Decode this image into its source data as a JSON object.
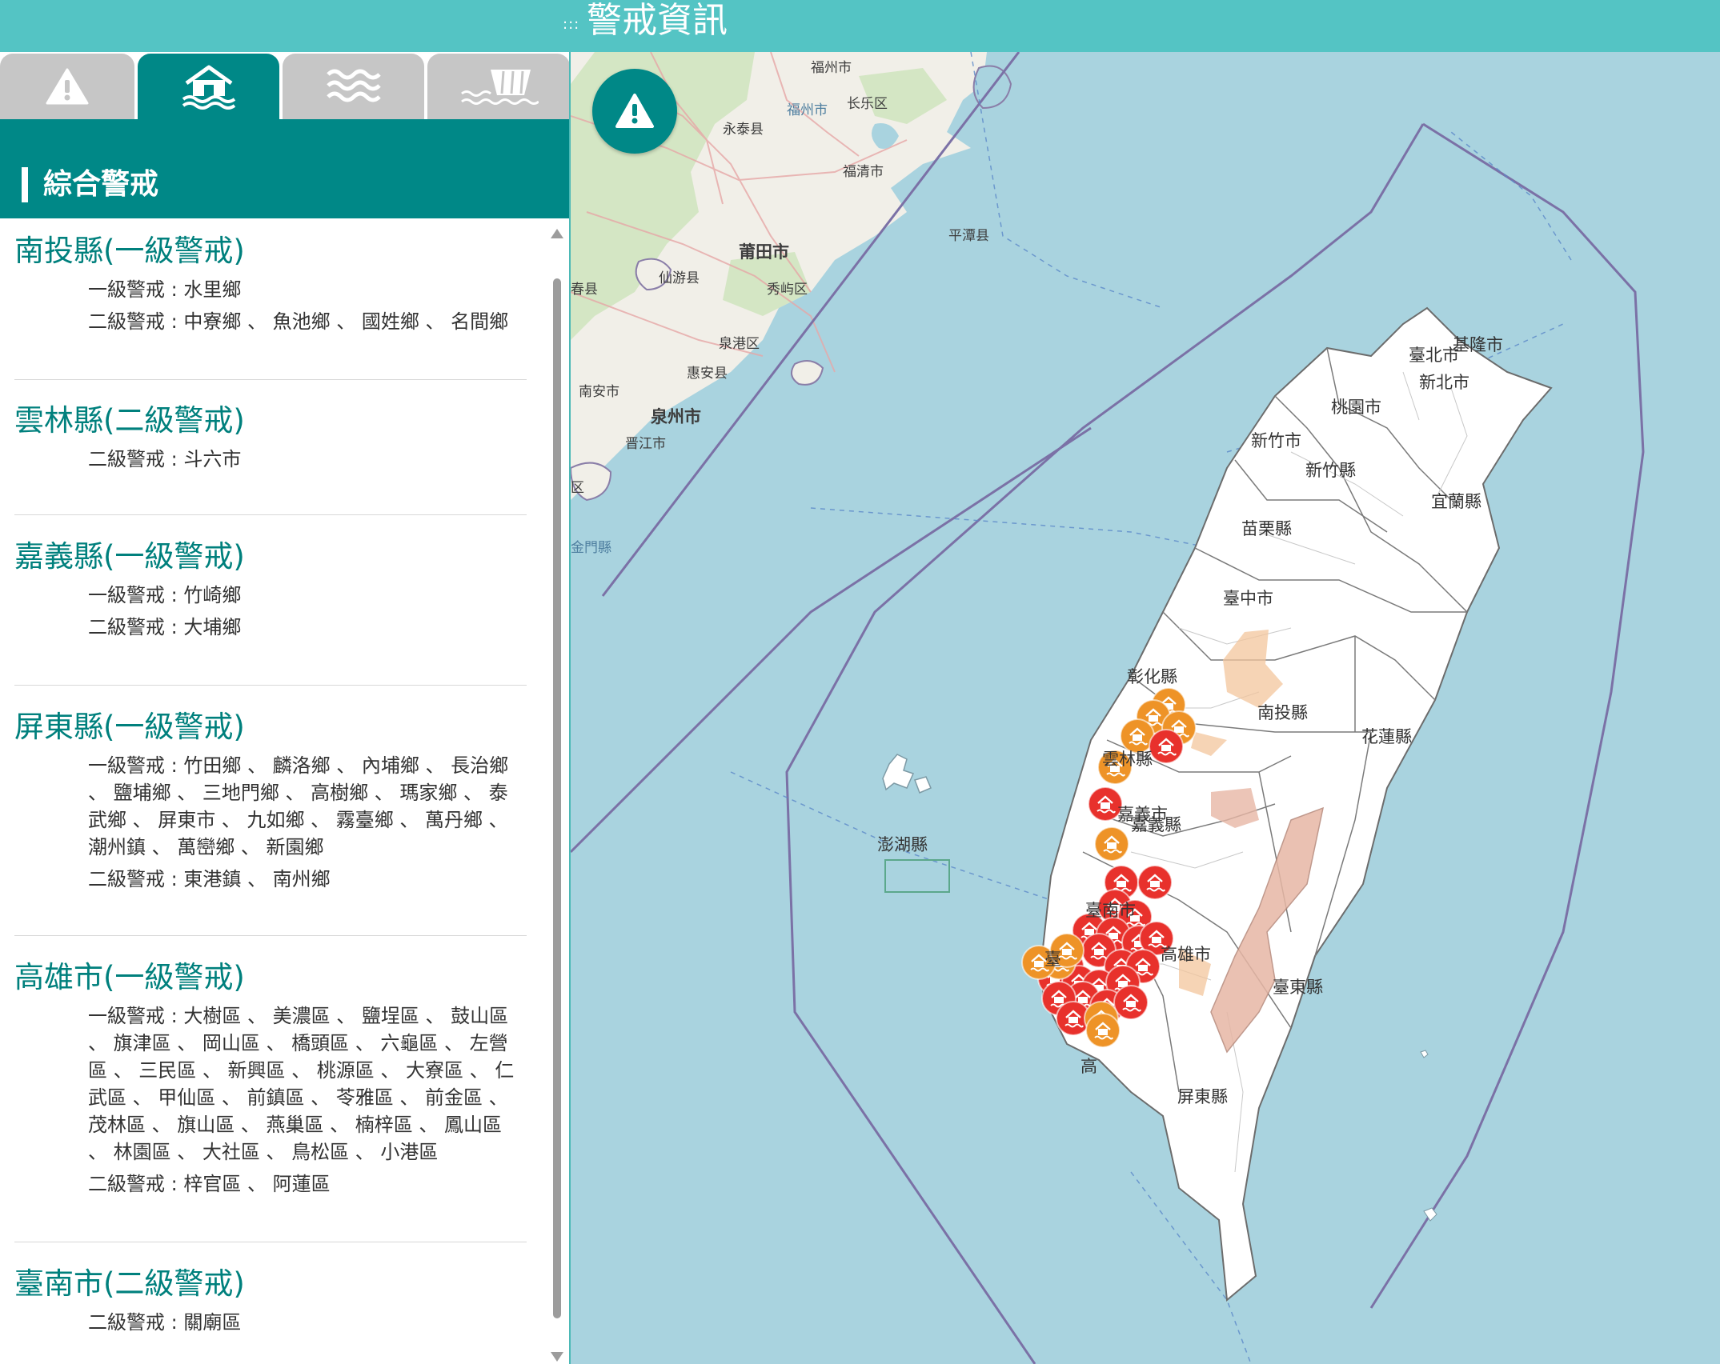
{
  "header": {
    "title": "警戒資訊",
    "handle": ":::"
  },
  "tabs": [
    {
      "id": "warning",
      "icon": "warning-icon",
      "active": false
    },
    {
      "id": "flood-house",
      "icon": "flooded-house-icon",
      "active": true
    },
    {
      "id": "water",
      "icon": "waves-icon",
      "active": false
    },
    {
      "id": "reservoir",
      "icon": "reservoir-icon",
      "active": false
    }
  ],
  "panel": {
    "title": "綜合警戒"
  },
  "counties": [
    {
      "name": "南投縣(一級警戒)",
      "lines": [
        "一級警戒 : 水里鄉",
        "二級警戒 : 中寮鄉 、 魚池鄉 、 國姓鄉 、 名間鄉"
      ]
    },
    {
      "name": "雲林縣(二級警戒)",
      "lines": [
        "二級警戒 : 斗六市"
      ]
    },
    {
      "name": "嘉義縣(一級警戒)",
      "lines": [
        "一級警戒 : 竹崎鄉",
        "二級警戒 : 大埔鄉"
      ]
    },
    {
      "name": "屏東縣(一級警戒)",
      "lines": [
        "一級警戒 : 竹田鄉 、 麟洛鄉 、 內埔鄉 、 長治鄉 、 鹽埔鄉 、 三地門鄉 、 高樹鄉 、 瑪家鄉 、 泰武鄉 、 屏東市 、 九如鄉 、 霧臺鄉 、 萬丹鄉 、 潮州鎮 、 萬巒鄉 、 新園鄉",
        "二級警戒 : 東港鎮 、 南州鄉"
      ]
    },
    {
      "name": "高雄市(一級警戒)",
      "lines": [
        "一級警戒 : 大樹區 、 美濃區 、 鹽埕區 、 鼓山區 、 旗津區 、 岡山區 、 橋頭區 、 六龜區 、 左營區 、 三民區 、 新興區 、 桃源區 、 大寮區 、 仁武區 、 甲仙區 、 前鎮區 、 苓雅區 、 前金區 、 茂林區 、 旗山區 、 燕巢區 、 楠梓區 、 鳳山區 、 林園區 、 大社區 、 鳥松區 、 小港區",
        "二級警戒 : 梓官區 、 阿蓮區"
      ]
    },
    {
      "name": "臺南市(二級警戒)",
      "lines": [
        "二級警戒 : 關廟區"
      ]
    }
  ],
  "map": {
    "labels": {
      "keelung": "基隆市",
      "taipei": "臺北市",
      "newtaipei": "新北市",
      "taoyuan": "桃園市",
      "hsinchucity": "新竹市",
      "hsinchucounty": "新竹縣",
      "yilan": "宜蘭縣",
      "miaoli": "苗栗縣",
      "taichung": "臺中市",
      "changhua": "彰化縣",
      "nantou": "南投縣",
      "hualien": "花蓮縣",
      "yunlin": "雲林縣",
      "chiayicounty": "嘉義縣",
      "chiayicity": "嘉義市",
      "penghu": "澎湖縣",
      "tainan": "臺南市",
      "kaohsiung": "高雄市",
      "taitung": "臺東縣",
      "pingtung": "屏東縣",
      "fuzhou": "福州市",
      "fuzhou2": "福州市",
      "changle": "长乐区",
      "yongtai": "永泰县",
      "fuqing": "福清市",
      "pingtan": "平潭县",
      "putian": "莆田市",
      "xianyou": "仙游县",
      "xiuyu": "秀屿区",
      "quangang": "泉港区",
      "huian": "惠安县",
      "nanan": "南安市",
      "quanzhou": "泉州市",
      "jinjiang": "晋江市",
      "kinmen": "金門縣",
      "chun": "春县",
      "qu": "区",
      "tai": "臺",
      "gao": "高"
    },
    "alert_colors": {
      "level1": "#e8312c",
      "level2": "#ee9327",
      "area_level1": "#e7b7a5",
      "area_level2": "#f3c69c"
    },
    "markers": [
      {
        "county": "南投縣",
        "level": 2
      },
      {
        "county": "南投縣",
        "level": 2
      },
      {
        "county": "南投縣",
        "level": 2
      },
      {
        "county": "南投縣",
        "level": 2
      },
      {
        "county": "南投縣",
        "level": 1
      },
      {
        "county": "雲林縣",
        "level": 2
      },
      {
        "county": "嘉義縣",
        "level": 1
      },
      {
        "county": "嘉義縣",
        "level": 2
      },
      {
        "county": "高雄市",
        "level": 1
      },
      {
        "county": "高雄市",
        "level": 1
      },
      {
        "county": "高雄市",
        "level": 1
      },
      {
        "county": "高雄市",
        "level": 1
      },
      {
        "county": "高雄市",
        "level": 1
      },
      {
        "county": "高雄市",
        "level": 1
      },
      {
        "county": "高雄市",
        "level": 1
      },
      {
        "county": "高雄市",
        "level": 1
      },
      {
        "county": "高雄市",
        "level": 1
      },
      {
        "county": "高雄市",
        "level": 1
      },
      {
        "county": "高雄市",
        "level": 1
      },
      {
        "county": "高雄市",
        "level": 1
      },
      {
        "county": "屏東縣",
        "level": 1
      },
      {
        "county": "屏東縣",
        "level": 1
      },
      {
        "county": "屏東縣",
        "level": 1
      },
      {
        "county": "屏東縣",
        "level": 1
      },
      {
        "county": "屏東縣",
        "level": 1
      },
      {
        "county": "屏東縣",
        "level": 1
      },
      {
        "county": "屏東縣",
        "level": 1
      },
      {
        "county": "屏東縣",
        "level": 1
      },
      {
        "county": "屏東縣",
        "level": 1
      },
      {
        "county": "屏東縣",
        "level": 2
      },
      {
        "county": "屏東縣",
        "level": 2
      },
      {
        "county": "高雄市",
        "level": 2
      },
      {
        "county": "高雄市",
        "level": 2
      },
      {
        "county": "高雄市",
        "level": 2
      }
    ]
  }
}
